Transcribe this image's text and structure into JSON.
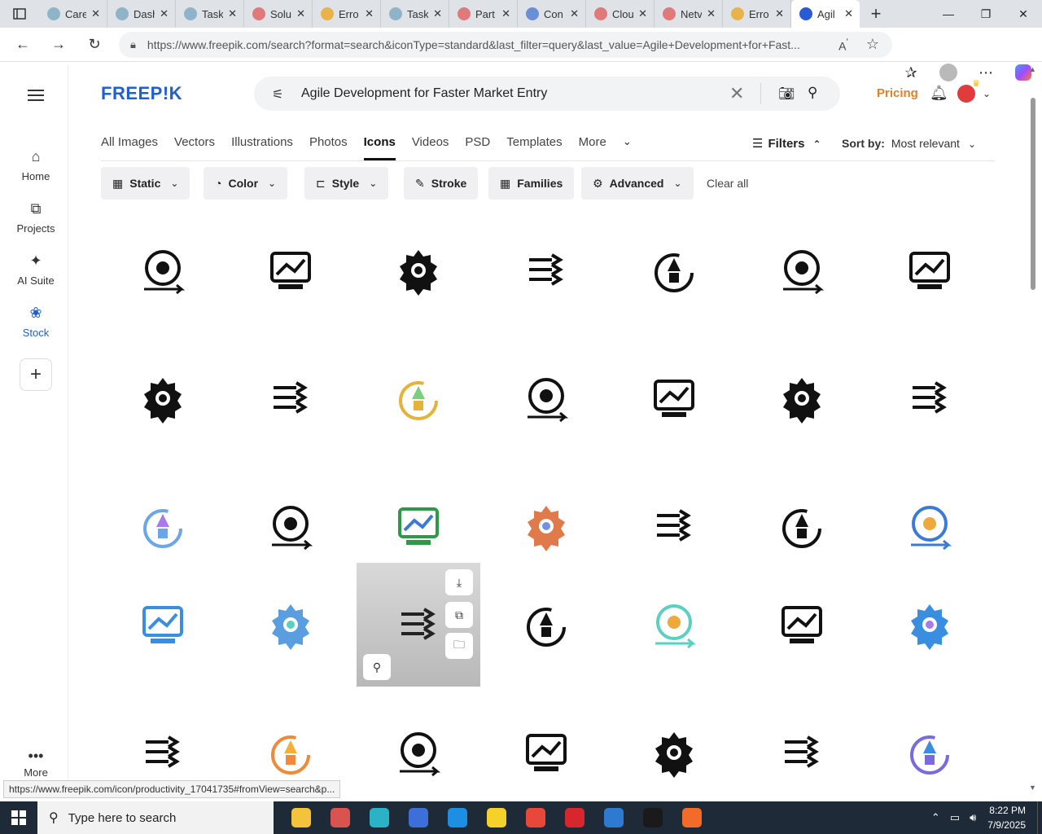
{
  "browser": {
    "tabs": [
      {
        "label": "Care",
        "color": "#8fb3c9"
      },
      {
        "label": "Dash",
        "color": "#8fb3c9"
      },
      {
        "label": "Task",
        "color": "#8fb3c9"
      },
      {
        "label": "Solu",
        "color": "#e07a7a"
      },
      {
        "label": "Erro",
        "color": "#e8b34a"
      },
      {
        "label": "Task",
        "color": "#8fb3c9"
      },
      {
        "label": "Part",
        "color": "#e07a7a"
      },
      {
        "label": "Con",
        "color": "#6a8fd6"
      },
      {
        "label": "Clou",
        "color": "#e07a7a"
      },
      {
        "label": "Netv",
        "color": "#e07a7a"
      },
      {
        "label": "Erro",
        "color": "#e8b34a"
      },
      {
        "label": "Agil",
        "color": "#2a5bd7"
      }
    ],
    "url": "https://www.freepik.com/search?format=search&iconType=standard&last_filter=query&last_value=Agile+Development+for+Fast..."
  },
  "sidebar": {
    "items": [
      {
        "label": "Home",
        "icon": "home-icon"
      },
      {
        "label": "Projects",
        "icon": "projects-icon"
      },
      {
        "label": "AI Suite",
        "icon": "sparkle-icon"
      },
      {
        "label": "Stock",
        "icon": "stock-icon"
      }
    ],
    "more": "More"
  },
  "header": {
    "logo": "FREEP!K",
    "search_query": "Agile Development for Faster Market Entry",
    "pricing": "Pricing"
  },
  "categories": [
    "All Images",
    "Vectors",
    "Illustrations",
    "Photos",
    "Icons",
    "Videos",
    "PSD",
    "Templates",
    "More"
  ],
  "active_category": "Icons",
  "filters_label": "Filters",
  "sort": {
    "label": "Sort by:",
    "value": "Most relevant"
  },
  "chips": [
    {
      "label": "Static",
      "icon": "static-icon",
      "dropdown": true
    },
    {
      "label": "Color",
      "icon": "palette-icon",
      "dropdown": true
    },
    {
      "label": "Style",
      "icon": "brush-icon",
      "dropdown": true
    },
    {
      "label": "Stroke",
      "icon": "pen-icon",
      "dropdown": false
    },
    {
      "label": "Families",
      "icon": "grid-icon",
      "dropdown": false
    },
    {
      "label": "Advanced",
      "icon": "gear-icon",
      "dropdown": true
    }
  ],
  "clear_all": "Clear all",
  "status_url": "https://www.freepik.com/icon/productivity_17041735#fromView=search&p...",
  "taskbar": {
    "search_placeholder": "Type here to search",
    "time": "8:22 PM",
    "date": "7/9/2025",
    "apps": [
      "#f2c33b",
      "#d9534f",
      "#2ab3c6",
      "#3d6fd9",
      "#1d8fe3",
      "#f5d22a",
      "#e8483a",
      "#d8262f",
      "#2e7ad1",
      "#1a1a1a",
      "#f26b2a"
    ]
  }
}
